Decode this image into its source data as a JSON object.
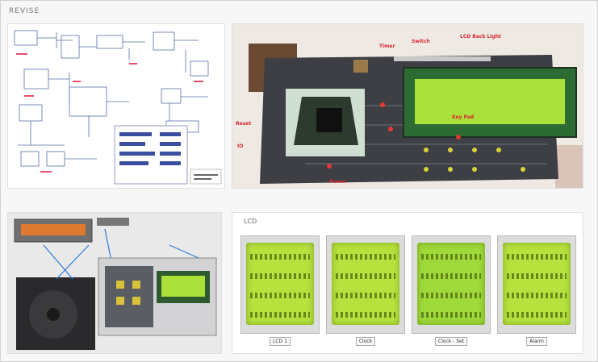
{
  "page": {
    "section_title": "REVISE"
  },
  "board_labels": {
    "top_right": "LCD Back Light",
    "top_mid": "Switch",
    "top_left": "Timer",
    "left_mid": "Reset",
    "left_low": "IO",
    "bottom": "Power",
    "mid": "Key Pad"
  },
  "lcd_section": {
    "title": "LCD"
  },
  "lcd_cards": [
    {
      "caption": "LCD 1"
    },
    {
      "caption": "Clock"
    },
    {
      "caption": "Clock - Set"
    },
    {
      "caption": "Alarm"
    }
  ],
  "colors": {
    "lcd_green": "#b7e23d",
    "board_dark": "#3d3f45",
    "accent_red": "#d8272e"
  }
}
